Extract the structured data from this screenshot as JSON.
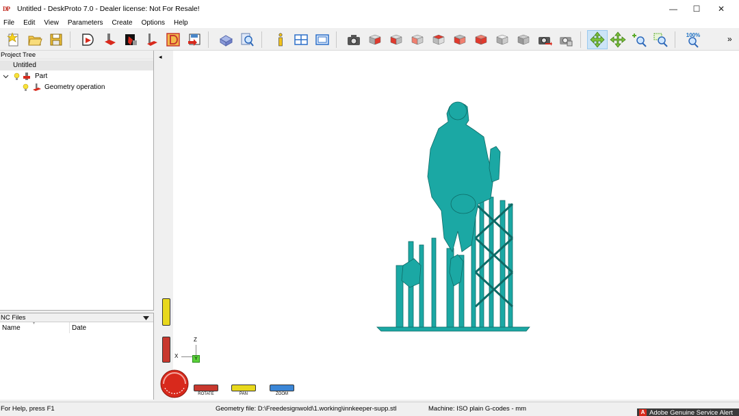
{
  "window": {
    "logo": "DP",
    "title": "Untitled - DeskProto 7.0 - Dealer license: Not For Resale!",
    "minimize": "—",
    "maximize": "☐",
    "close": "✕"
  },
  "menu": [
    "File",
    "Edit",
    "View",
    "Parameters",
    "Create",
    "Options",
    "Help"
  ],
  "toolbar": {
    "zoom_level": "100%",
    "overflow": "»",
    "active_tool": "rotate-view",
    "buttons": [
      "new",
      "open",
      "save",
      "import-geometry",
      "part-parameters",
      "operation-parameters",
      "vector-operation",
      "bitmap-operation",
      "write-nc",
      "simulation",
      "preview",
      "information",
      "layout",
      "properties",
      "screenshot",
      "view-front",
      "view-back",
      "view-left",
      "view-right",
      "view-top",
      "view-bottom",
      "view-iso",
      "view-custom",
      "render-mode",
      "redraw",
      "rotate-view",
      "pan-view",
      "zoom-in",
      "zoom-window",
      "zoom-100"
    ]
  },
  "project_tree": {
    "header": "Project Tree",
    "root": "Untitled",
    "part": "Part",
    "operation": "Geometry operation"
  },
  "nc_files": {
    "header": "NC Files",
    "columns": [
      "Name",
      "Date"
    ]
  },
  "viewport": {
    "collapse_arrow": "◂",
    "axes": {
      "z": "Z",
      "x": "X",
      "y": "Y"
    },
    "model_color": "#1ba8a4",
    "controls": [
      {
        "label": "ROTATE",
        "color": "#c8382e"
      },
      {
        "label": "PAN",
        "color": "#e8d81c"
      },
      {
        "label": "ZOOM",
        "color": "#3b86d6"
      }
    ]
  },
  "statusbar": {
    "help": "For Help, press F1",
    "geometry_file": "Geometry file: D:\\Freedesignwold\\1.working\\innkeeper-supp.stl",
    "machine": "Machine: ISO plain G-codes - mm",
    "adobe_alert": "Adobe Genuine Service Alert",
    "adobe_icon": "A"
  }
}
